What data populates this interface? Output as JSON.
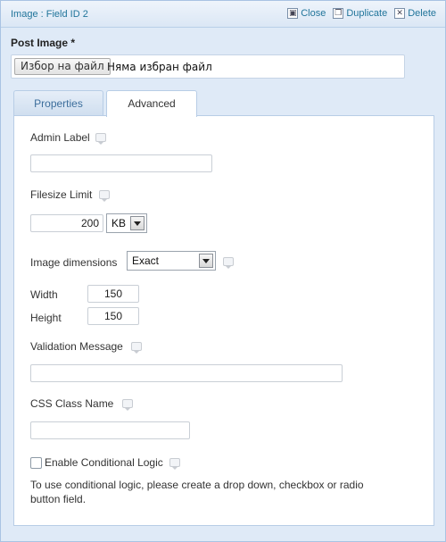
{
  "header": {
    "title": "Image : Field ID 2",
    "actions": {
      "close": "Close",
      "duplicate": "Duplicate",
      "delete": "Delete"
    }
  },
  "field": {
    "label": "Post Image *",
    "file_button": "Избор на файл",
    "file_status": "Няма избран файл"
  },
  "tabs": {
    "properties": "Properties",
    "advanced": "Advanced"
  },
  "advanced": {
    "admin_label": {
      "label": "Admin Label",
      "value": ""
    },
    "filesize_limit": {
      "label": "Filesize Limit",
      "value": "200",
      "unit": "KB"
    },
    "image_dimensions": {
      "label": "Image dimensions",
      "selected": "Exact"
    },
    "width": {
      "label": "Width",
      "value": "150"
    },
    "height": {
      "label": "Height",
      "value": "150"
    },
    "validation_message": {
      "label": "Validation Message",
      "value": ""
    },
    "css_class": {
      "label": "CSS Class Name",
      "value": ""
    },
    "conditional_logic": {
      "label": "Enable Conditional Logic",
      "checked": false,
      "note": "To use conditional logic, please create a drop down, checkbox or radio button field."
    }
  }
}
